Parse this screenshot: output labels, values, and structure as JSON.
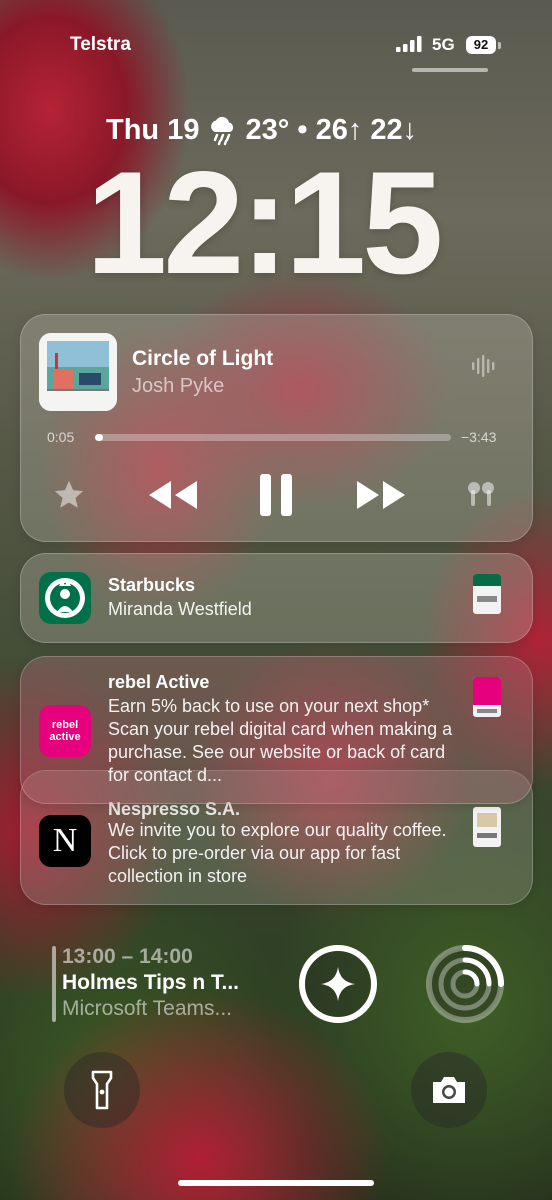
{
  "status": {
    "carrier": "Telstra",
    "network": "5G",
    "battery": "92"
  },
  "lock": {
    "date": "Thu 19",
    "weather_icon": "cloud-rain-icon",
    "weather": "23° • 26↑ 22↓",
    "time": "12:15"
  },
  "now_playing": {
    "song": "Circle of Light",
    "artist": "Josh Pyke",
    "elapsed": "0:05",
    "remaining": "−3:43",
    "progress": 0.02
  },
  "notifications": [
    {
      "app": "Starbucks",
      "body": "Miranda Westfield"
    },
    {
      "app": "rebel Active",
      "icon_text": "rebel active",
      "body": "Earn 5% back to use on your next shop* Scan your rebel digital card when making a purchase. See our website or back of card for contact d..."
    },
    {
      "app": "Nespresso S.A.",
      "icon_text": "N",
      "body": "We invite you to explore our quality coffee. Click to pre-order via our app for fast collection in store"
    }
  ],
  "calendar": {
    "time": "13:00 – 14:00",
    "title": "Holmes Tips n T...",
    "subtitle": "Microsoft Teams..."
  },
  "colors": {
    "starbucks": "#00704A",
    "rebel": "#E6007E",
    "nespresso": "#000000"
  }
}
